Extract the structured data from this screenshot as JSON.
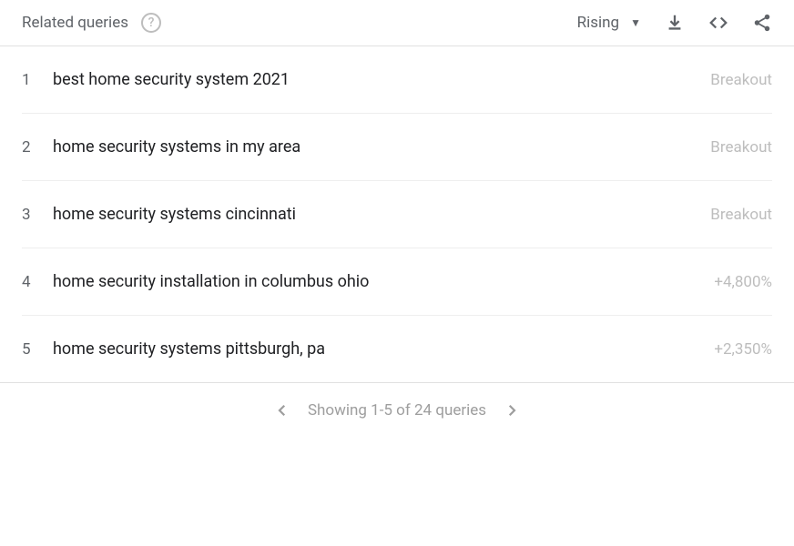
{
  "header": {
    "title": "Related queries",
    "dropdown_label": "Rising"
  },
  "rows": [
    {
      "rank": "1",
      "query": "best home security system 2021",
      "value": "Breakout"
    },
    {
      "rank": "2",
      "query": "home security systems in my area",
      "value": "Breakout"
    },
    {
      "rank": "3",
      "query": "home security systems cincinnati",
      "value": "Breakout"
    },
    {
      "rank": "4",
      "query": "home security installation in columbus ohio",
      "value": "+4,800%"
    },
    {
      "rank": "5",
      "query": "home security systems pittsburgh, pa",
      "value": "+2,350%"
    }
  ],
  "pagination": {
    "text": "Showing 1-5 of 24 queries"
  }
}
